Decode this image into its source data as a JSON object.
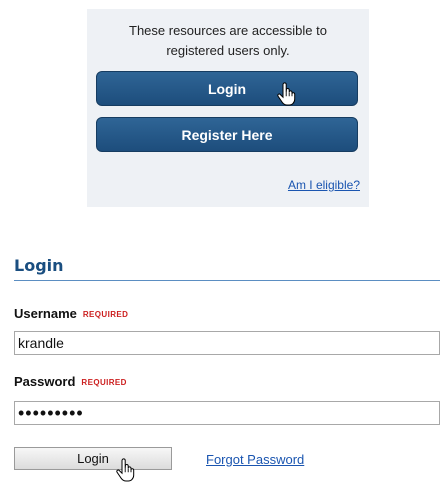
{
  "access_panel": {
    "message_line1": "These resources are accessible to",
    "message_line2": "registered users only.",
    "login_button": "Login",
    "register_button": "Register Here",
    "eligible_link": "Am I eligible?"
  },
  "login_form": {
    "heading": "Login",
    "username_label": "Username",
    "username_required": "REQUIRED",
    "username_value": "krandle",
    "password_label": "Password",
    "password_required": "REQUIRED",
    "password_value": "•••••••••",
    "submit_button": "Login",
    "forgot_link": "Forgot Password"
  },
  "colors": {
    "primary_button": "#245888",
    "panel_bg": "#eef1f5",
    "link": "#1a55b0",
    "heading": "#1a4e80",
    "required": "#cc1f1f"
  }
}
